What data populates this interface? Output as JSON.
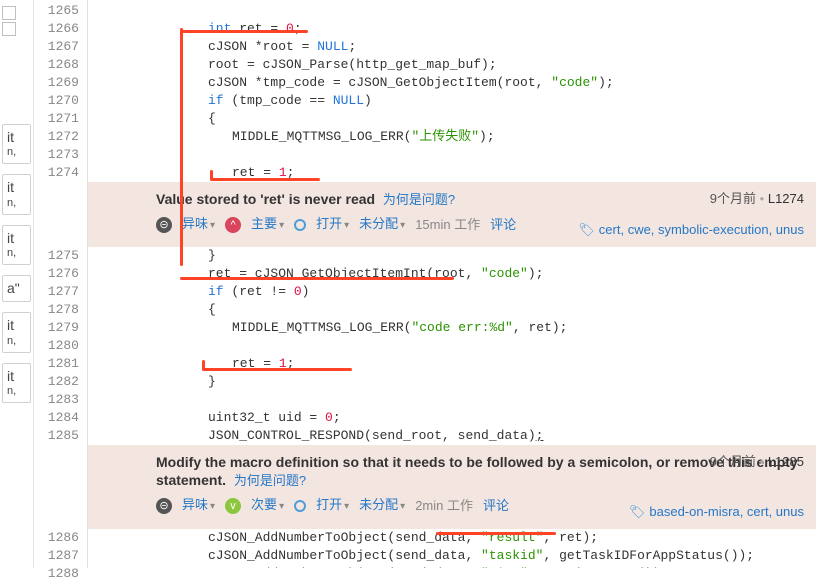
{
  "tiles": [
    {
      "t": "it",
      "s": "n,"
    },
    {
      "t": "it",
      "s": "n,"
    },
    {
      "t": "it",
      "s": "n,"
    },
    {
      "t": "a\"",
      "s": ""
    },
    {
      "t": "it",
      "s": "n,"
    },
    {
      "t": "it",
      "s": "n,"
    }
  ],
  "line_numbers": [
    "1265",
    "1266",
    "1267",
    "1268",
    "1269",
    "1270",
    "1271",
    "1272",
    "1273",
    "1274",
    "1275",
    "1276",
    "1277",
    "1278",
    "1279",
    "1280",
    "1281",
    "1282",
    "1283",
    "1284",
    "1285",
    "1286",
    "1287",
    "1288"
  ],
  "issue1": {
    "title_strong": "Value stored to 'ret' is never read",
    "why": "为何是问题?",
    "type": "异味",
    "severity": "主要",
    "status": "打开",
    "assignment": "未分配",
    "effort": "15min 工作",
    "comments": "评论",
    "age": "9个月前",
    "line_ref": "L1274",
    "tags": "cert, cwe, symbolic-execution, unus"
  },
  "issue2": {
    "title_strong": "Modify the macro definition so that it needs to be followed by a semicolon, or remove this empty statement.",
    "why": "为何是问题?",
    "type": "异味",
    "severity": "次要",
    "status": "打开",
    "assignment": "未分配",
    "effort": "2min 工作",
    "comments": "评论",
    "age": "9个月前",
    "line_ref": "L1285",
    "tags": "based-on-misra, cert, unus"
  },
  "code": {
    "l1266": "int ret = 0;",
    "l1267": "cJSON *root = NULL;",
    "l1268": "root = cJSON_Parse(http_get_map_buf);",
    "l1269": "cJSON *tmp_code = cJSON_GetObjectItem(root, \"code\");",
    "l1270": "if (tmp_code == NULL)",
    "l1271": "{",
    "l1272": "MIDDLE_MQTTMSG_LOG_ERR(\"上传失败\");",
    "l1274": "ret = 1;",
    "l1275": "}",
    "l1276": "ret = cJSON_GetObjectItemInt(root, \"code\");",
    "l1277": "if (ret != 0)",
    "l1278": "{",
    "l1279": "MIDDLE_MQTTMSG_LOG_ERR(\"code err:%d\", ret);",
    "l1281": "ret = 1;",
    "l1282": "}",
    "l1284": "uint32_t uid = 0;",
    "l1285": "JSON_CONTROL_RESPOND(send_root, send_data);",
    "l1286": "cJSON_AddNumberToObject(send_data, \"result\", ret);",
    "l1287": "cJSON_AddNumberToObject(send_data, \"taskid\", getTaskIDForAppStatus());",
    "l1288": "cJSON AddNumberToObject(send_data, \"time\", getTimestamp());"
  }
}
